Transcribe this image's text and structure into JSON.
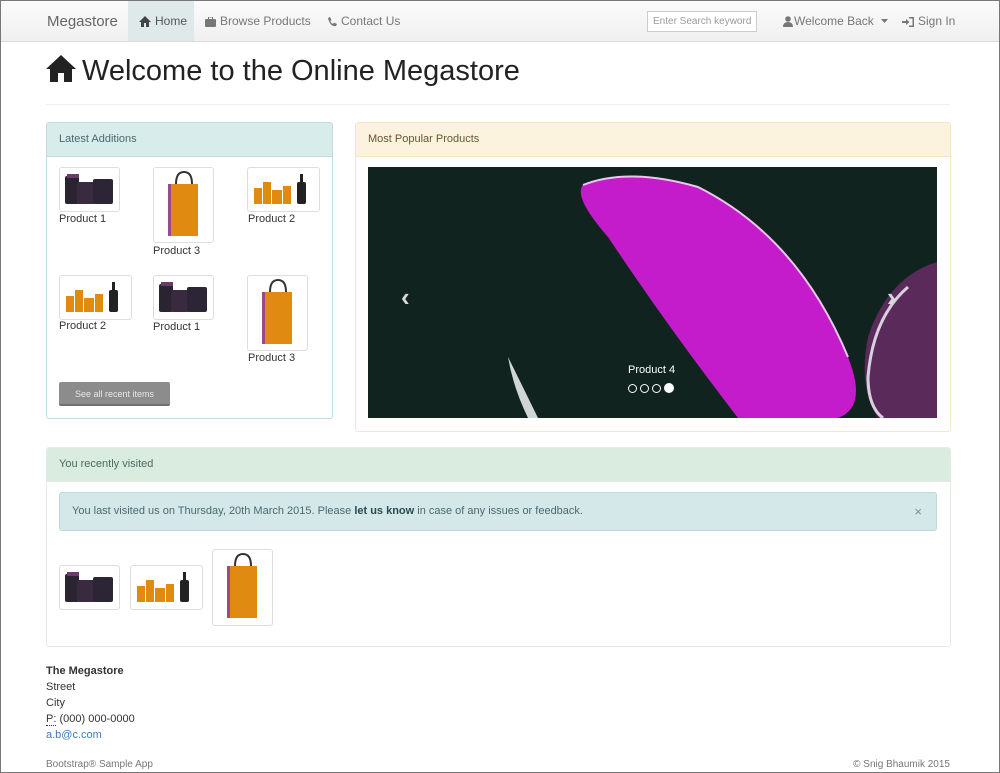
{
  "navbar": {
    "brand": "Megastore",
    "home": "Home",
    "browse": "Browse Products",
    "contact": "Contact Us",
    "search_placeholder": "Enter Search keyword",
    "welcome": "Welcome Back",
    "signin": "Sign In"
  },
  "page": {
    "title": "Welcome to the Online Megastore"
  },
  "latest": {
    "heading": "Latest Additions",
    "items": [
      "Product 1",
      "Product 3",
      "Product 2",
      "Product 2",
      "Product 1",
      "Product 3"
    ],
    "button": "See all recent items"
  },
  "popular": {
    "heading": "Most Popular Products",
    "caption": "Product 4",
    "slides_total": 4,
    "active_slide": 4,
    "prev": "‹",
    "next": "›"
  },
  "recent": {
    "heading": "You recently visited",
    "alert_pre": "You last visited us on Thursday, 20th March 2015. Please ",
    "alert_link": "let us know",
    "alert_post": " in case of any issues or feedback.",
    "close": "×"
  },
  "footer": {
    "name": "The Megastore",
    "street": "Street",
    "city": "City",
    "phone_label": "P:",
    "phone": "(000) 000-0000",
    "email": "a.b@c.com",
    "left": "Bootstrap® Sample App",
    "right": "© Snig Bhaumik 2015"
  },
  "colors": {
    "accent_info": "#d9ecec",
    "accent_warn": "#fbf3de",
    "product_orange": "#e08a12"
  }
}
